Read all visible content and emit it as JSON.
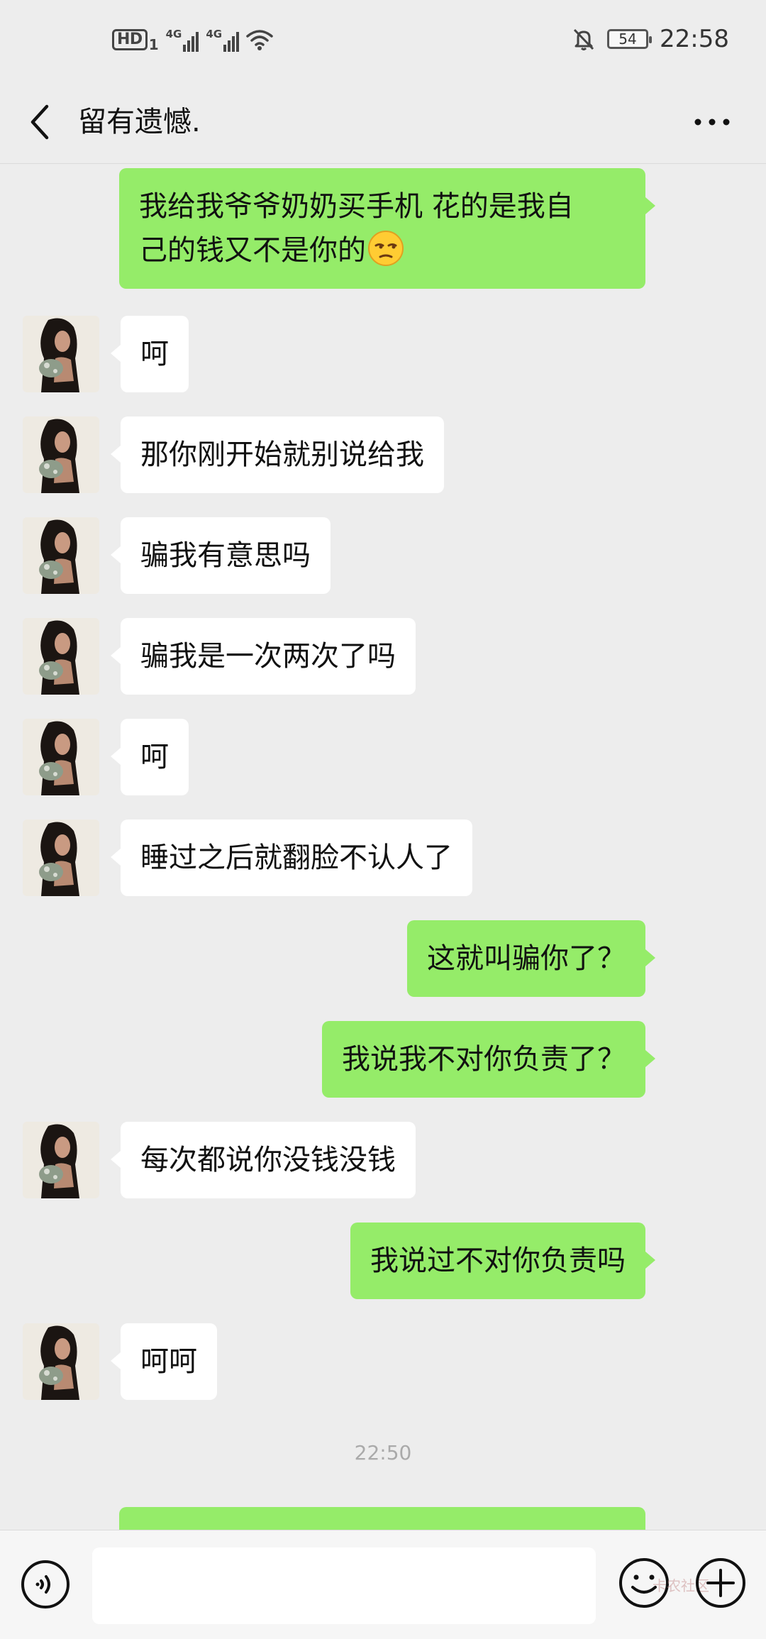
{
  "status_bar": {
    "hd_label": "HD",
    "sim_index": "1",
    "signal_label": "4G",
    "battery": "54",
    "time": "22:58"
  },
  "header": {
    "title": "留有遗憾."
  },
  "messages": [
    {
      "side": "sent",
      "text": "我给我爷爷奶奶买手机 花的是我自",
      "text_line2": "己的钱又不是你的",
      "emoji": "unamused-face"
    },
    {
      "side": "recv",
      "text": "呵"
    },
    {
      "side": "recv",
      "text": "那你刚开始就别说给我"
    },
    {
      "side": "recv",
      "text": "骗我有意思吗"
    },
    {
      "side": "recv",
      "text": "骗我是一次两次了吗"
    },
    {
      "side": "recv",
      "text": "呵"
    },
    {
      "side": "recv",
      "text": "睡过之后就翻脸不认人了"
    },
    {
      "side": "sent",
      "text": "这就叫骗你了？"
    },
    {
      "side": "sent",
      "text": "我说我不对你负责了？"
    },
    {
      "side": "recv",
      "text": "每次都说你没钱没钱"
    },
    {
      "side": "sent",
      "text": "我说过不对你负责吗"
    },
    {
      "side": "recv",
      "text": "呵呵"
    }
  ],
  "timestamp": "22:50",
  "input": {
    "value": "",
    "placeholder": ""
  },
  "watermark": "卡农社区",
  "icons": {
    "back": "chevron-left-icon",
    "more": "more-dots-icon",
    "voice": "voice-icon",
    "emoji": "emoji-icon",
    "plus": "plus-icon"
  },
  "colors": {
    "background": "#ededed",
    "sent_bubble": "#95ec69",
    "recv_bubble": "#ffffff",
    "input_bar": "#f6f6f6"
  }
}
